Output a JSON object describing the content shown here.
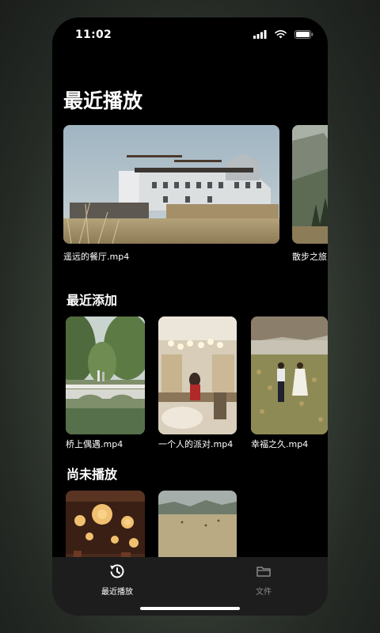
{
  "status": {
    "time": "11:02"
  },
  "page_title": "最近播放",
  "recently_played": [
    {
      "title": "遥远的餐厅.mp4"
    },
    {
      "title": "散步之旅."
    }
  ],
  "recently_added": {
    "title": "最近添加",
    "items": [
      {
        "title": "桥上偶遇.mp4"
      },
      {
        "title": "一个人的派对.mp4"
      },
      {
        "title": "幸福之久.mp4"
      }
    ]
  },
  "not_played": {
    "title": "尚未播放"
  },
  "tabs": [
    {
      "label": "最近播放",
      "icon": "history-icon",
      "active": true
    },
    {
      "label": "文件",
      "icon": "folder-icon",
      "active": false
    }
  ],
  "colors": {
    "active_tab": "#ffffff",
    "inactive_tab": "#8a8a8a"
  }
}
